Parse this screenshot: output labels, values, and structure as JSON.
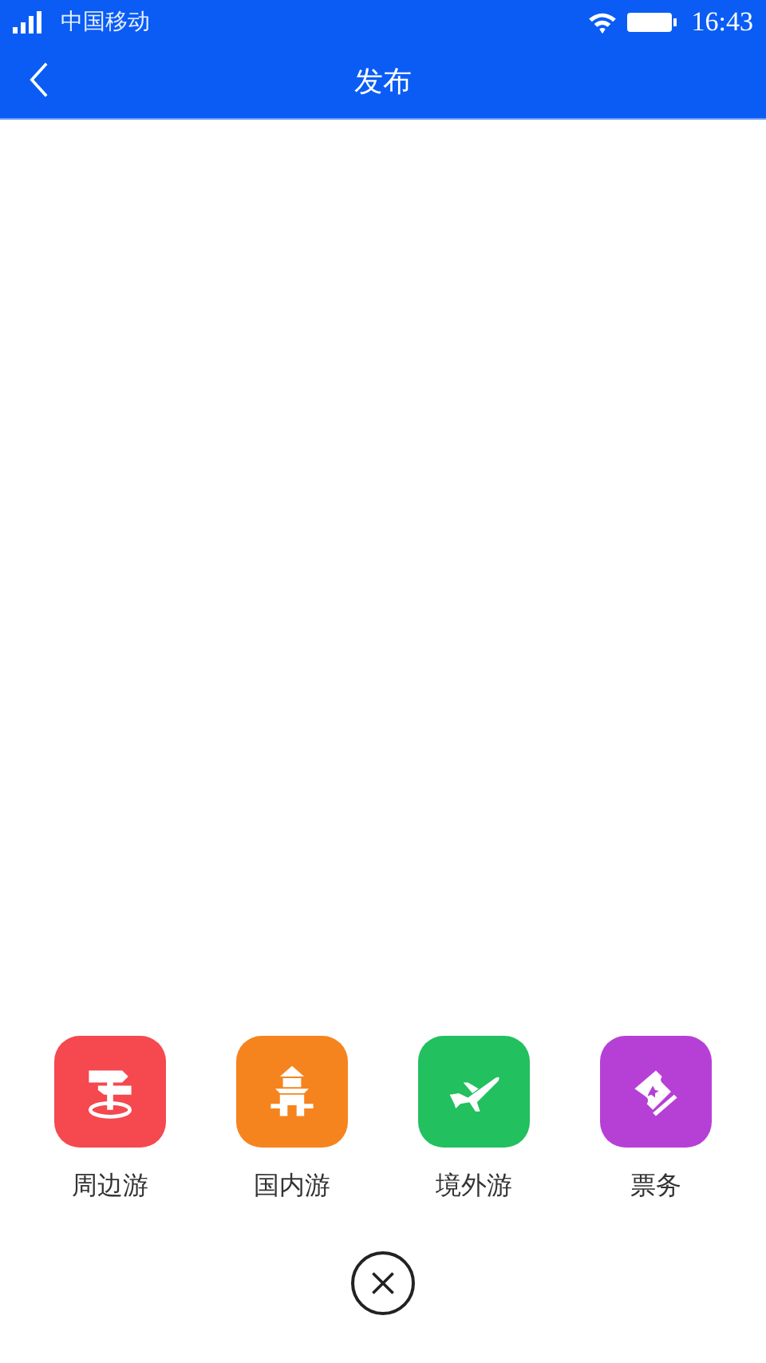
{
  "status_bar": {
    "carrier": "中国移动",
    "time": "16:43"
  },
  "nav": {
    "title": "发布"
  },
  "categories": [
    {
      "kind": "signpost",
      "label": "周边游",
      "color": "#f5484f"
    },
    {
      "kind": "pagoda",
      "label": "国内游",
      "color": "#f6841e"
    },
    {
      "kind": "plane",
      "label": "境外游",
      "color": "#22c05e"
    },
    {
      "kind": "ticket",
      "label": "票务",
      "color": "#b640d6"
    }
  ]
}
